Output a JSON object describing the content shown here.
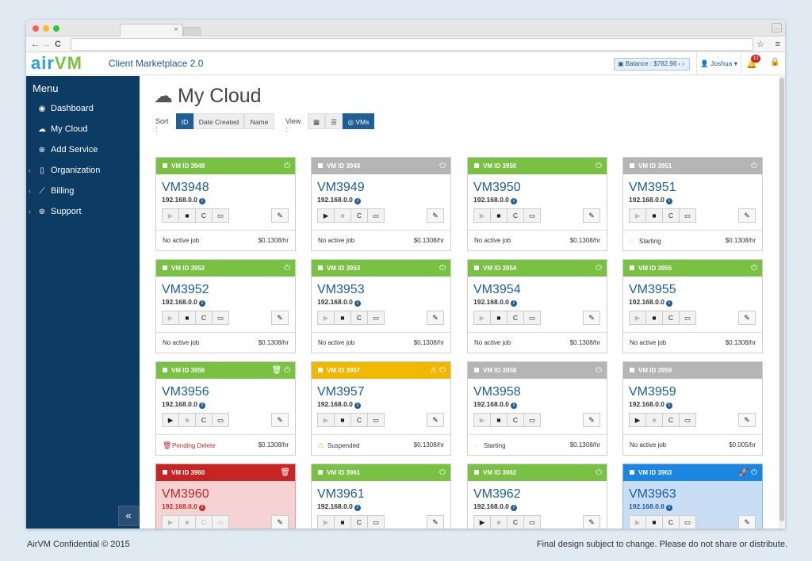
{
  "browser": {
    "tab_close": "×",
    "ext_button": "…",
    "back": "←",
    "forward": "→",
    "reload": "C",
    "star": "☆",
    "menu": "≡"
  },
  "header": {
    "logo_part1": "air",
    "logo_part2": "VM",
    "app_title": "Client Marketplace 2.0",
    "balance": "Balance : $782.98",
    "user": "Joshua",
    "notifications": "12"
  },
  "sidebar": {
    "title": "Menu",
    "items": [
      {
        "label": "Dashboard",
        "icon": "dashboard-icon",
        "glyph": "◉",
        "caret": ""
      },
      {
        "label": "My Cloud",
        "icon": "cloud-icon",
        "glyph": "☁",
        "caret": ""
      },
      {
        "label": "Add Service",
        "icon": "plus-circle-icon",
        "glyph": "⊕",
        "caret": ""
      },
      {
        "label": "Organization",
        "icon": "building-icon",
        "glyph": "▯",
        "caret": "‹"
      },
      {
        "label": "Billing",
        "icon": "chart-icon",
        "glyph": "⟋",
        "caret": "‹"
      },
      {
        "label": "Support",
        "icon": "lifebuoy-icon",
        "glyph": "⊛",
        "caret": "‹"
      }
    ],
    "collapse": "«"
  },
  "main": {
    "title": "My Cloud",
    "sort_label": "Sort :",
    "sort_options": [
      "ID",
      "Date Created",
      "Name"
    ],
    "view_label": "View :",
    "view_options": [
      "▦",
      "☰",
      "◎ VMs"
    ]
  },
  "colors": {
    "green": "#79c142",
    "gray": "#b5b5b5",
    "yellow": "#f0b800",
    "red": "#c92424",
    "blue": "#1b86e0"
  },
  "vms": [
    {
      "header": "VM ID 3948",
      "name": "VM3948",
      "ip": "192.168.0.0",
      "status": "green",
      "icons": "⏻",
      "play_enabled": false,
      "footer": "No active job",
      "footer_icon": "",
      "price": "$0.1308/hr",
      "variant": ""
    },
    {
      "header": "VM ID 3949",
      "name": "VM3949",
      "ip": "192.168.0.0",
      "status": "gray",
      "icons": "⏻",
      "play_enabled": true,
      "footer": "No active job",
      "footer_icon": "",
      "price": "$0.1308/hr",
      "variant": ""
    },
    {
      "header": "VM ID 3950",
      "name": "VM3950",
      "ip": "192.168.0.0",
      "status": "green",
      "icons": "⏻",
      "play_enabled": false,
      "footer": "No active job",
      "footer_icon": "",
      "price": "$0.1308/hr",
      "variant": ""
    },
    {
      "header": "VM ID 3951",
      "name": "VM3951",
      "ip": "192.168.0.0",
      "status": "gray",
      "icons": "⏻",
      "play_enabled": false,
      "footer": "Starting",
      "footer_icon": "spinner-icon",
      "price": "$0.1308/hr",
      "variant": ""
    },
    {
      "header": "VM ID 3952",
      "name": "VM3952",
      "ip": "192.168.0.0",
      "status": "green",
      "icons": "⏻",
      "play_enabled": false,
      "footer": "No active job",
      "footer_icon": "",
      "price": "$0.1308/hr",
      "variant": ""
    },
    {
      "header": "VM ID 3953",
      "name": "VM3953",
      "ip": "192.168.0.0",
      "status": "green",
      "icons": "⏻",
      "play_enabled": false,
      "footer": "No active job",
      "footer_icon": "",
      "price": "$0.1308/hr",
      "variant": ""
    },
    {
      "header": "VM ID 3954",
      "name": "VM3954",
      "ip": "192.168.0.0",
      "status": "green",
      "icons": "⏻",
      "play_enabled": false,
      "footer": "No active job",
      "footer_icon": "",
      "price": "$0.1308/hr",
      "variant": ""
    },
    {
      "header": "VM ID 3955",
      "name": "VM3955",
      "ip": "192.168.0.0",
      "status": "green",
      "icons": "⏻",
      "play_enabled": false,
      "footer": "No active job",
      "footer_icon": "",
      "price": "$0.1308/hr",
      "variant": ""
    },
    {
      "header": "VM ID 3956",
      "name": "VM3956",
      "ip": "192.168.0.0",
      "status": "green",
      "icons": "🗑 ⏻",
      "play_enabled": true,
      "footer": "Pending Delete",
      "footer_icon": "trash-icon",
      "price": "$0.1308/hr",
      "variant": ""
    },
    {
      "header": "VM ID 3957",
      "name": "VM3957",
      "ip": "192.168.0.0",
      "status": "yellow",
      "icons": "⚠ ⏻",
      "play_enabled": false,
      "footer": "Suspended",
      "footer_icon": "warning-icon",
      "price": "$0.1308/hr",
      "variant": ""
    },
    {
      "header": "VM ID 3958",
      "name": "VM3958",
      "ip": "192.168.0.0",
      "status": "gray",
      "icons": "⏻",
      "play_enabled": false,
      "footer": "Starting",
      "footer_icon": "spinner-icon",
      "price": "$0.1308/hr",
      "variant": ""
    },
    {
      "header": "VM ID 3959",
      "name": "VM3959",
      "ip": "192.168.0.0",
      "status": "gray",
      "icons": "",
      "play_enabled": true,
      "footer": "No active job",
      "footer_icon": "",
      "price": "$0.005/hr",
      "variant": ""
    },
    {
      "header": "VM ID 3960",
      "name": "VM3960",
      "ip": "192.168.0.0",
      "status": "red",
      "icons": "🗑",
      "play_enabled": false,
      "footer": "",
      "footer_icon": "",
      "price": "",
      "variant": "red"
    },
    {
      "header": "VM ID 3961",
      "name": "VM3961",
      "ip": "192.168.0.0",
      "status": "green",
      "icons": "⏻",
      "play_enabled": false,
      "footer": "",
      "footer_icon": "",
      "price": "",
      "variant": ""
    },
    {
      "header": "VM ID 3962",
      "name": "VM3962",
      "ip": "192.168.0.0",
      "status": "green",
      "icons": "⏻",
      "play_enabled": true,
      "footer": "",
      "footer_icon": "",
      "price": "",
      "variant": ""
    },
    {
      "header": "VM ID 3963",
      "name": "VM3963",
      "ip": "192.168.0.8",
      "status": "blue",
      "icons": "🚀 ⏻",
      "play_enabled": false,
      "footer": "",
      "footer_icon": "",
      "price": "",
      "variant": "blue"
    }
  ],
  "control_glyphs": {
    "play": "▶",
    "stop": "■",
    "restart": "C",
    "console": "▭",
    "wrench": "✎"
  },
  "footer": {
    "left": "AirVM Confidential © 2015",
    "right": "Final design subject to change. Please do not share or distribute."
  }
}
